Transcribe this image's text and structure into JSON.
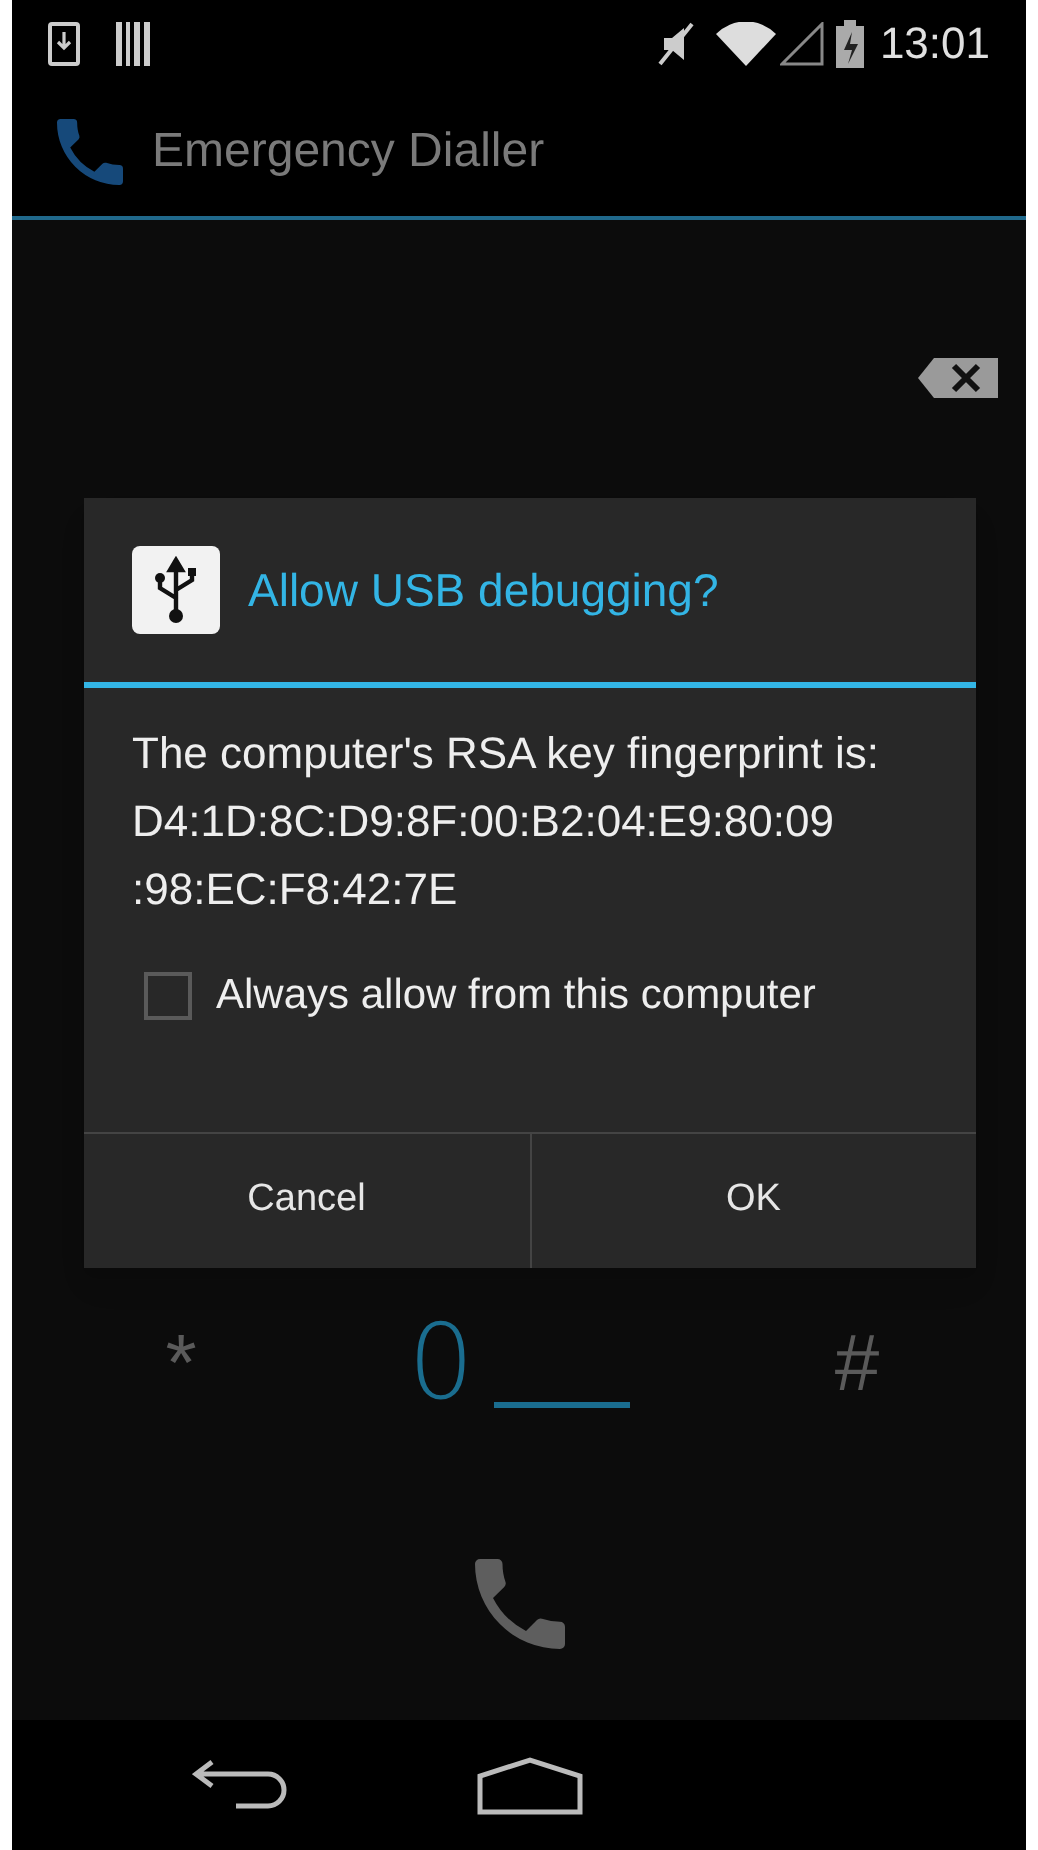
{
  "status_bar": {
    "time": "13:01"
  },
  "action_bar": {
    "title": "Emergency Dialler"
  },
  "keypad": {
    "keys": [
      {
        "label": "*",
        "selected": false
      },
      {
        "label": "0",
        "selected": true
      },
      {
        "label": "#",
        "selected": false
      }
    ]
  },
  "dialog": {
    "title": "Allow USB debugging?",
    "message": "The computer's RSA key fingerprint is:\nD4:1D:8C:D9:8F:00:B2:04:E9:80:09\n:98:EC:F8:42:7E",
    "checkbox": {
      "label": "Always allow from this computer",
      "checked": false
    },
    "buttons": [
      "Cancel",
      "OK"
    ]
  }
}
